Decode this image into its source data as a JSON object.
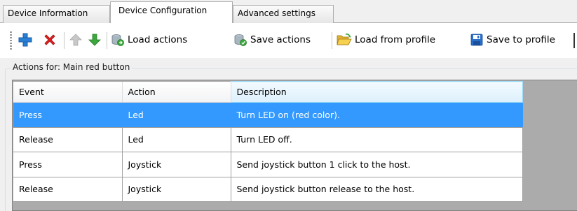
{
  "tabs": [
    {
      "label": "Device Information"
    },
    {
      "label": "Device Configuration"
    },
    {
      "label": "Advanced settings"
    }
  ],
  "active_tab": "Device Configuration",
  "toolbar": {
    "add_icon": "plus-icon",
    "delete_icon": "red-x-icon",
    "move_up_icon": "arrow-up-icon",
    "move_down_icon": "arrow-down-icon",
    "load_actions": "Load actions",
    "save_actions": "Save actions",
    "load_from_profile": "Load from profile",
    "save_to_profile": "Save to profile"
  },
  "group": {
    "title": "Actions for: Main red button"
  },
  "table": {
    "columns": [
      "Event",
      "Action",
      "Description"
    ],
    "rows": [
      {
        "event": "Press",
        "action": "Led",
        "description": "Turn LED on (red color)."
      },
      {
        "event": "Release",
        "action": "Led",
        "description": "Turn LED off."
      },
      {
        "event": "Press",
        "action": "Joystick",
        "description": "Send joystick button 1 click to the host."
      },
      {
        "event": "Release",
        "action": "Joystick",
        "description": "Send joystick button release to the host."
      }
    ],
    "selected_row": 0
  },
  "colors": {
    "selection": "#3399ff",
    "grid_background": "#ababab",
    "add": "#2a7fd4",
    "delete": "#e02020",
    "move_down": "#3aa83a"
  }
}
